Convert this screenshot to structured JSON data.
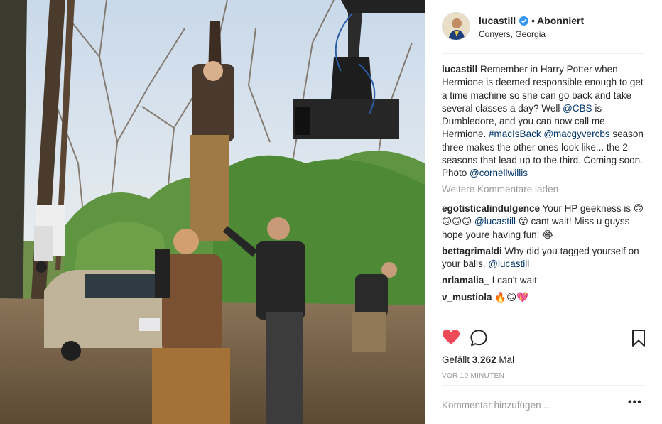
{
  "post": {
    "username": "lucastill",
    "follow_separator": "•",
    "follow_status": "Abonniert",
    "location": "Conyers, Georgia",
    "verified_icon": "verified-badge-icon"
  },
  "caption": {
    "username": "lucastill",
    "text_1": "Remember in Harry Potter when Hermione is deemed responsible enough to get a time machine so she can go back and take several classes a day? Well",
    "mention_1": "@CBS",
    "text_2": "is Dumbledore, and you can now call me Hermione.",
    "tag_1": "#macIsBack",
    "mention_2": "@macgyvercbs",
    "text_3": "season three makes the other ones look like... the 2 seasons that lead up to the third. Coming soon. Photo",
    "mention_3": "@cornellwillis"
  },
  "load_more": "Weitere Kommentare laden",
  "comments": [
    {
      "user": "egotisticalindulgence",
      "text_a": "Your HP geekness is 🙃🙃🙃🙃",
      "mention": "@lucastill",
      "text_b": "😮 cant wait! Miss u guyss hope youre having fun! 😂"
    },
    {
      "user": "bettagrimaldi",
      "text_a": "Why did you tagged yourself on your balls.",
      "mention": "@lucastill",
      "text_b": ""
    },
    {
      "user": "nrlamalia_",
      "text_a": "I can't wait",
      "mention": "",
      "text_b": ""
    },
    {
      "user": "v_mustiola",
      "text_a": "🔥🙃💖",
      "mention": "",
      "text_b": ""
    }
  ],
  "actions": {
    "like_icon": "heart-icon",
    "comment_icon": "comment-icon",
    "save_icon": "bookmark-icon",
    "liked": true,
    "like_color": "#ed4956"
  },
  "likes_prefix": "Gefällt",
  "likes_count": "3.262",
  "likes_suffix": "Mal",
  "timestamp": "VOR 10 MINUTEN",
  "add_comment_placeholder": "Kommentar hinzufügen ...",
  "more_options": "•••"
}
